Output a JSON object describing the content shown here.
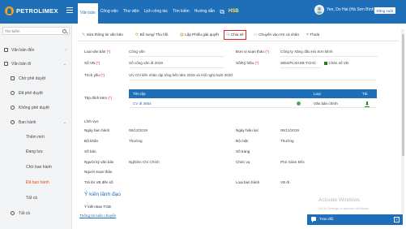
{
  "app": {
    "logo_text": "PETROLIMEX",
    "brand_color": "#1e6fb8"
  },
  "header": {
    "menu": [
      {
        "label": "Văn bản",
        "active": true
      },
      {
        "label": "Công việc"
      },
      {
        "label": "Thư viện"
      },
      {
        "label": "Lịch công tác"
      },
      {
        "label": "Tìm kiếm"
      },
      {
        "label": "Hướng dẫn"
      }
    ],
    "external_icon": "external-link-icon",
    "hsb_label": "HSB",
    "user_name": "Yen, Do Hai (Hà Sơn Bình)",
    "logout_label": "Đăng xuất"
  },
  "sidebar": {
    "search_placeholder": "Tìm kiếm",
    "items": [
      {
        "label": "Văn bản đến",
        "icon": "inbox-icon",
        "chevron": "›"
      },
      {
        "label": "Văn bản đi",
        "icon": "outbox-icon",
        "chevron": "⌄"
      },
      {
        "label": "Chờ phê duyệt",
        "icon": "hourglass-icon"
      },
      {
        "label": "Đã phê duyệt",
        "icon": "check-circle-icon"
      },
      {
        "label": "Không phê duyệt",
        "icon": "block-icon"
      },
      {
        "label": "Ban hành",
        "icon": "send-icon",
        "chevron": "⌄"
      },
      {
        "label": "Thêm mới"
      },
      {
        "label": "Đang lưu"
      },
      {
        "label": "Chờ ban hành"
      },
      {
        "label": "Đã ban hành",
        "selected": true
      },
      {
        "label": "Tất cả"
      },
      {
        "label": "Tất cả",
        "icon": "database-icon"
      }
    ]
  },
  "toolbar": {
    "items": [
      {
        "label": "Sửa thông tin văn bản",
        "icon": "pencil-icon"
      },
      {
        "label": "Bổ sung/ Thu hồi",
        "icon": "refresh-icon"
      },
      {
        "label": "Lập Phiếu giải quyết",
        "icon": "document-icon"
      },
      {
        "label": "Chia sẻ",
        "icon": "users-icon",
        "highlighted": true
      },
      {
        "label": "Chuyển vào HS cá nhân",
        "icon": "folder-icon"
      },
      {
        "label": "Thoát",
        "icon": "close-icon"
      }
    ]
  },
  "form": {
    "loai_van_ban_label": "Loại văn bản",
    "loai_van_ban_value": "Công văn",
    "don_vi_soan_thao_label": "Đơn vị soạn thảo",
    "don_vi_soan_thao_value": "Công ty Xăng dầu Hà Sơn Bình",
    "so_vb_label": "Số VB",
    "so_vb_value": "Số công văn đi 2019",
    "so_ky_hieu_label": "Số/Ký hiệu",
    "so_ky_hieu_value": "3654/PLXHSB-TCHC",
    "chen_so_vb_label": "Chèn số VB",
    "trich_yeu_label": "Trích yếu",
    "trich_yeu_value": "V/v Chỉ tiền nhân dịp tổng kết năm 2019 và Hội nghị NLĐ 2020",
    "tep_dinh_kem_label": "Tệp đính kèm",
    "attachments_header": {
      "name": "Tên tệp",
      "type": "Loại",
      "action": "Tải"
    },
    "attachments": [
      {
        "name": "CV đi 3654",
        "type": "Văn bản chính"
      }
    ],
    "linh_vuc_label": "Lĩnh vực",
    "ngay_ban_hanh_label": "Ngày ban hành",
    "ngay_ban_hanh_value": "06/12/2019",
    "ngay_hieu_luc_label": "Ngày hiệu lực",
    "ngay_hieu_luc_value": "06/12/2019",
    "do_khan_label": "Độ khẩn",
    "do_khan_value": "Thường",
    "do_mat_label": "Độ mật",
    "do_mat_value": "Thường",
    "so_ban_label": "Số bản",
    "so_trang_label": "Số trang",
    "nguoi_ky_label": "Người ký văn bản",
    "nguoi_ky_value": "Nghiêm Chí Chính",
    "chuc_vu_label": "Chức vụ",
    "chuc_vu_value": "Phó Giám Đốc",
    "nguoi_soan_thao_label": "Người soạn thảo",
    "tra_loi_vb_label": "Trả lời VB đến số",
    "loai_ban_hanh_label": "Loại ban hành",
    "loai_ban_hanh_value": "VB đi",
    "y_kien_lanh_dao_title": "Ý kiến lãnh đạo",
    "y_kien_ban_tgd_label": "Ý kiến Ban TGĐ",
    "thong_tin_luan_chuyen_label": "Thông tin luân chuyển"
  },
  "watermark": {
    "title": "Activate Windows",
    "subtitle": "Go to Settings to activate Windows."
  },
  "chat": {
    "label": "Trao đổi",
    "close": "×"
  }
}
